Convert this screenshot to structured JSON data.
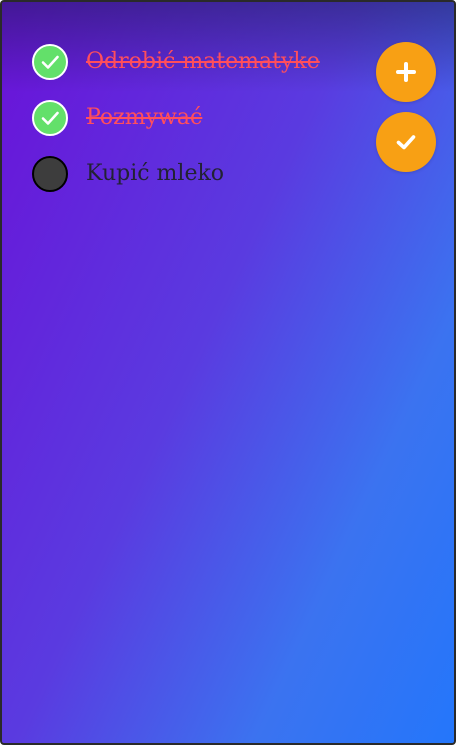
{
  "todos": [
    {
      "text": "Odrobić matematyke",
      "done": true
    },
    {
      "text": "Pozmywać",
      "done": true
    },
    {
      "text": "Kupić mleko",
      "done": false
    }
  ],
  "actions": {
    "add_icon": "plus-icon",
    "complete_icon": "check-icon"
  },
  "colors": {
    "gradient_start": "#6a12d8",
    "gradient_end": "#2476fb",
    "done_check": "#63e06a",
    "done_text": "#ff4e5c",
    "pending_circle": "#3d3d3d",
    "fab": "#f8a014"
  }
}
